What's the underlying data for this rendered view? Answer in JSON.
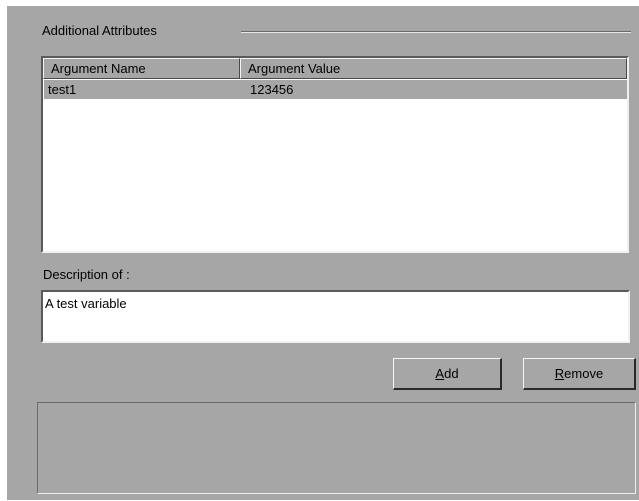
{
  "group": {
    "title": "Additional Attributes"
  },
  "list": {
    "columns": [
      "Argument Name",
      "Argument Value"
    ],
    "rows": [
      {
        "name": "test1",
        "value": "123456",
        "selected": true
      }
    ]
  },
  "description": {
    "label": "Description of :",
    "value": "A test variable"
  },
  "buttons": {
    "add_mnemonic": "A",
    "add_rest": "dd",
    "remove_mnemonic": "R",
    "remove_rest": "emove"
  },
  "colors": {
    "panel": "#a6a6a6",
    "field_background": "#ffffff",
    "selection": "#a6a6a6"
  }
}
